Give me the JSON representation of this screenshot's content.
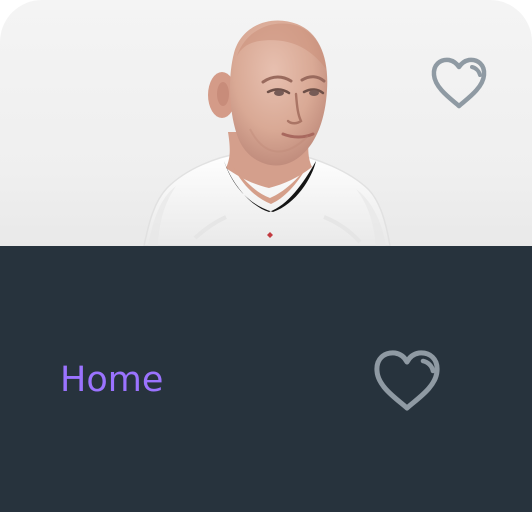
{
  "product_card": {
    "image": {
      "subject": "person-wearing-white-jersey"
    },
    "favorite_icon": "heart-outline-icon"
  },
  "bottom_nav": {
    "home_label": "Home",
    "favorite_icon": "heart-outline-icon"
  },
  "colors": {
    "card_background": "#efefef",
    "nav_background": "#27333d",
    "accent_purple": "#9b73ff",
    "heart_gray": "#8f9aa3"
  }
}
